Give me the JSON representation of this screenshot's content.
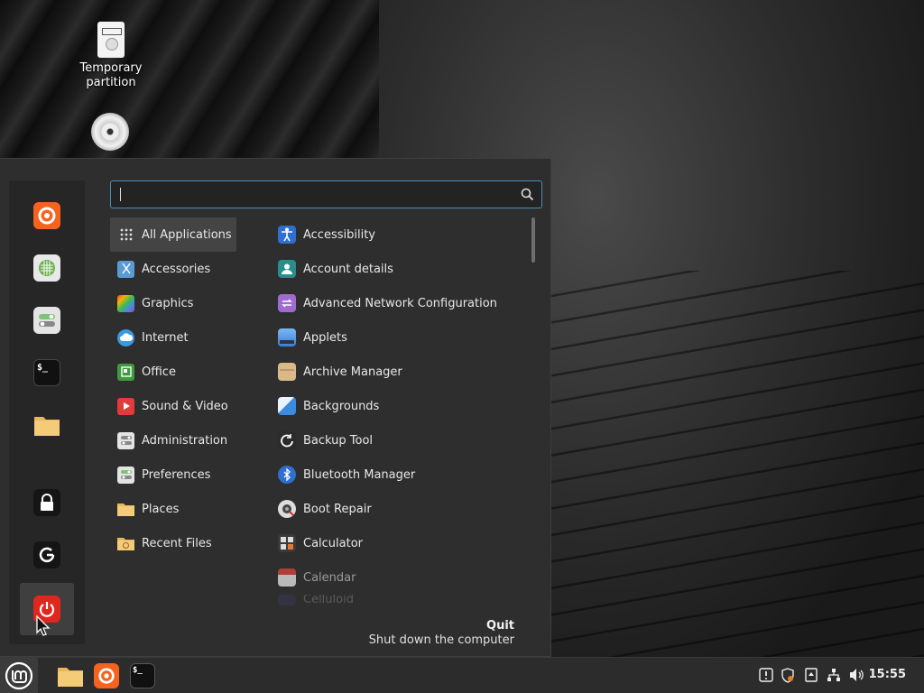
{
  "desktop": {
    "icons": [
      {
        "label": "Temporary partition",
        "icon": "sd-card-icon"
      },
      {
        "label": "",
        "icon": "optical-disc-icon"
      }
    ]
  },
  "favorites": [
    {
      "name": "firefox",
      "icon": "firefox-icon"
    },
    {
      "name": "software-manager",
      "icon": "software-manager-icon"
    },
    {
      "name": "system-settings",
      "icon": "settings-toggle-icon"
    },
    {
      "name": "terminal",
      "icon": "terminal-icon"
    },
    {
      "name": "files",
      "icon": "folder-icon"
    },
    {
      "name": "lock-screen",
      "icon": "lock-icon"
    },
    {
      "name": "logout",
      "icon": "logout-icon"
    },
    {
      "name": "quit",
      "icon": "power-icon"
    }
  ],
  "search": {
    "value": "",
    "placeholder": ""
  },
  "categories": [
    {
      "label": "All Applications",
      "icon": "grid-icon"
    },
    {
      "label": "Accessories",
      "icon": "scissors-icon"
    },
    {
      "label": "Graphics",
      "icon": "graphics-icon"
    },
    {
      "label": "Internet",
      "icon": "cloud-icon"
    },
    {
      "label": "Office",
      "icon": "office-icon"
    },
    {
      "label": "Sound & Video",
      "icon": "play-icon"
    },
    {
      "label": "Administration",
      "icon": "administration-icon"
    },
    {
      "label": "Preferences",
      "icon": "preferences-icon"
    },
    {
      "label": "Places",
      "icon": "folder-icon"
    },
    {
      "label": "Recent Files",
      "icon": "recent-folder-icon"
    }
  ],
  "applications": [
    {
      "label": "Accessibility",
      "icon": "accessibility-icon"
    },
    {
      "label": "Account details",
      "icon": "account-icon"
    },
    {
      "label": "Advanced Network Configuration",
      "icon": "network-config-icon"
    },
    {
      "label": "Applets",
      "icon": "applets-icon"
    },
    {
      "label": "Archive Manager",
      "icon": "archive-icon"
    },
    {
      "label": "Backgrounds",
      "icon": "backgrounds-icon"
    },
    {
      "label": "Backup Tool",
      "icon": "backup-icon"
    },
    {
      "label": "Bluetooth Manager",
      "icon": "bluetooth-icon"
    },
    {
      "label": "Boot Repair",
      "icon": "boot-repair-icon"
    },
    {
      "label": "Calculator",
      "icon": "calculator-icon"
    },
    {
      "label": "Calendar",
      "icon": "calendar-icon"
    },
    {
      "label": "Celluloid",
      "icon": "celluloid-icon"
    }
  ],
  "tooltip": {
    "title": "Quit",
    "description": "Shut down the computer"
  },
  "taskbar": {
    "apps": [
      {
        "name": "files",
        "icon": "folder-icon"
      },
      {
        "name": "firefox",
        "icon": "firefox-icon"
      },
      {
        "name": "terminal",
        "icon": "terminal-icon"
      }
    ],
    "tray": [
      {
        "name": "update-manager",
        "icon": "update-manager-icon"
      },
      {
        "name": "shield",
        "icon": "shield-icon"
      },
      {
        "name": "notes",
        "icon": "notes-icon"
      },
      {
        "name": "network",
        "icon": "network-icon"
      },
      {
        "name": "volume",
        "icon": "volume-icon"
      }
    ],
    "clock": "15:55"
  },
  "colors": {
    "accent": "#4a90b8",
    "menu_bg": "#2e2e2e",
    "taskbar_bg": "#2c2c2c"
  }
}
